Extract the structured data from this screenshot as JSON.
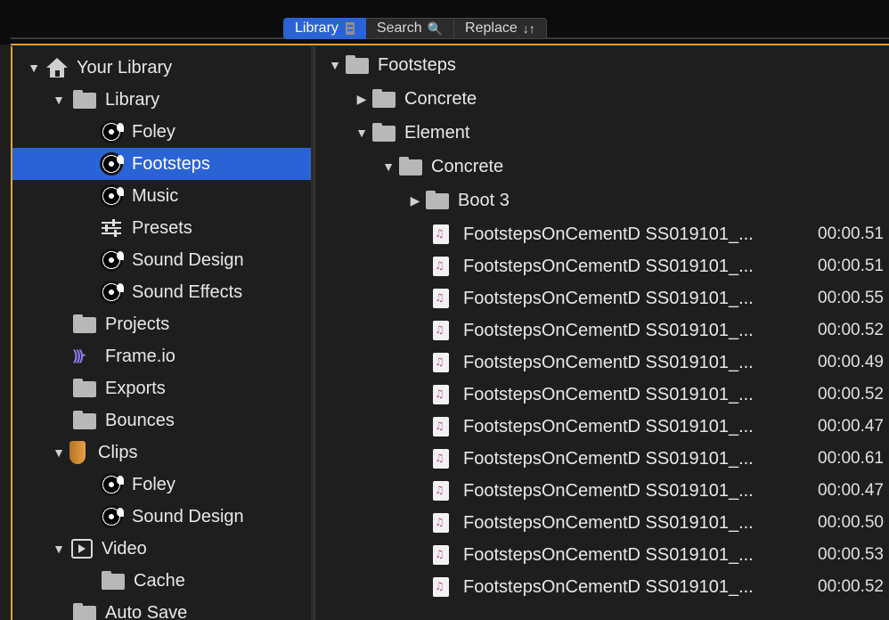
{
  "tabs": [
    {
      "label": "Library",
      "icon": "library-icon",
      "active": true
    },
    {
      "label": "Search",
      "icon": "search-icon",
      "active": false
    },
    {
      "label": "Replace",
      "icon": "arrows-swap-icon",
      "glyph": "↓↑",
      "active": false
    }
  ],
  "sidebar": {
    "items": [
      {
        "label": "Your Library",
        "icon": "home-icon",
        "tri": "▼"
      },
      {
        "label": "Library",
        "icon": "folder-icon",
        "tri": "▼"
      },
      {
        "label": "Foley",
        "icon": "sound-disc-icon",
        "tri": ""
      },
      {
        "label": "Footsteps",
        "icon": "sound-disc-icon",
        "tri": "",
        "selected": true
      },
      {
        "label": "Music",
        "icon": "sound-disc-icon",
        "tri": ""
      },
      {
        "label": "Presets",
        "icon": "sliders-icon",
        "tri": ""
      },
      {
        "label": "Sound Design",
        "icon": "sound-disc-icon",
        "tri": ""
      },
      {
        "label": "Sound Effects",
        "icon": "sound-disc-icon",
        "tri": ""
      },
      {
        "label": "Projects",
        "icon": "folder-icon",
        "tri": ""
      },
      {
        "label": "Frame.io",
        "icon": "frameio-icon",
        "tri": ""
      },
      {
        "label": "Exports",
        "icon": "folder-icon",
        "tri": ""
      },
      {
        "label": "Bounces",
        "icon": "folder-icon",
        "tri": ""
      },
      {
        "label": "Clips",
        "icon": "clips-shield-icon",
        "tri": "▼"
      },
      {
        "label": "Foley",
        "icon": "sound-disc-icon",
        "tri": ""
      },
      {
        "label": "Sound Design",
        "icon": "sound-disc-icon",
        "tri": ""
      },
      {
        "label": "Video",
        "icon": "video-icon",
        "tri": "▼"
      },
      {
        "label": "Cache",
        "icon": "folder-icon",
        "tri": ""
      },
      {
        "label": "Auto Save",
        "icon": "folder-icon",
        "tri": ""
      }
    ]
  },
  "browser": {
    "folders": [
      {
        "label": "Footsteps",
        "tri": "▼"
      },
      {
        "label": "Concrete",
        "tri": "▶"
      },
      {
        "label": "Element",
        "tri": "▼"
      },
      {
        "label": "Concrete",
        "tri": "▼"
      },
      {
        "label": "Boot 3",
        "tri": "▶"
      }
    ],
    "files": [
      {
        "name": "FootstepsOnCementD SS019101_...",
        "duration": "00:00.51"
      },
      {
        "name": "FootstepsOnCementD SS019101_...",
        "duration": "00:00.51"
      },
      {
        "name": "FootstepsOnCementD SS019101_...",
        "duration": "00:00.55"
      },
      {
        "name": "FootstepsOnCementD SS019101_...",
        "duration": "00:00.52"
      },
      {
        "name": "FootstepsOnCementD SS019101_...",
        "duration": "00:00.49"
      },
      {
        "name": "FootstepsOnCementD SS019101_...",
        "duration": "00:00.52"
      },
      {
        "name": "FootstepsOnCementD SS019101_...",
        "duration": "00:00.47"
      },
      {
        "name": "FootstepsOnCementD SS019101_...",
        "duration": "00:00.61"
      },
      {
        "name": "FootstepsOnCementD SS019101_...",
        "duration": "00:00.47"
      },
      {
        "name": "FootstepsOnCementD SS019101_...",
        "duration": "00:00.50"
      },
      {
        "name": "FootstepsOnCementD SS019101_...",
        "duration": "00:00.53"
      },
      {
        "name": "FootstepsOnCementD SS019101_...",
        "duration": "00:00.52"
      }
    ]
  },
  "colors": {
    "accent": "#e3a13a",
    "selection": "#2a63d6",
    "background": "#1e1e1e"
  }
}
